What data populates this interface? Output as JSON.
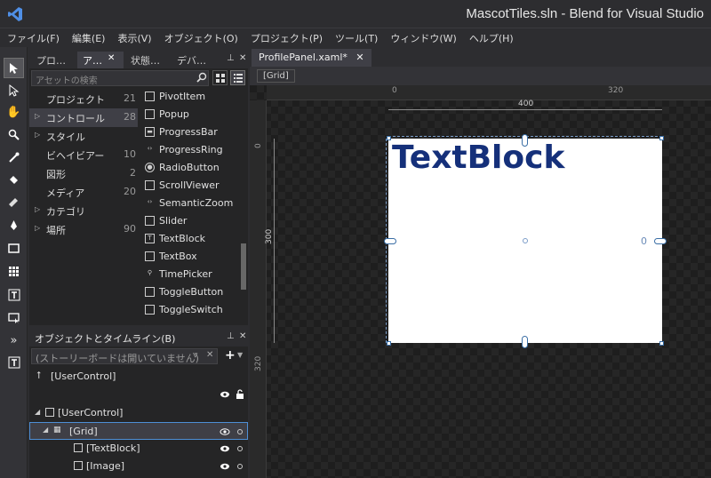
{
  "window": {
    "title": "MascotTiles.sln - Blend for Visual Studio"
  },
  "menu": [
    "ファイル(F)",
    "編集(E)",
    "表示(V)",
    "オブジェクト(O)",
    "プロジェクト(P)",
    "ツール(T)",
    "ウィンドウ(W)",
    "ヘルプ(H)"
  ],
  "panel_tabs": [
    "プロ…",
    "ア…",
    "状態…",
    "デバ…"
  ],
  "assets": {
    "search_placeholder": "アセットの検索",
    "categories": [
      {
        "label": "プロジェクト",
        "count": "21",
        "expandable": false
      },
      {
        "label": "コントロール",
        "count": "28",
        "expandable": true
      },
      {
        "label": "スタイル",
        "count": "",
        "expandable": true
      },
      {
        "label": "ビヘイビアー",
        "count": "10",
        "expandable": false
      },
      {
        "label": "図形",
        "count": "2",
        "expandable": false
      },
      {
        "label": "メディア",
        "count": "20",
        "expandable": false
      },
      {
        "label": "カテゴリ",
        "count": "",
        "expandable": true
      },
      {
        "label": "場所",
        "count": "90",
        "expandable": true
      }
    ],
    "items": [
      "PivotItem",
      "Popup",
      "ProgressBar",
      "ProgressRing",
      "RadioButton",
      "ScrollViewer",
      "SemanticZoom",
      "Slider",
      "TextBlock",
      "TextBox",
      "TimePicker",
      "ToggleButton",
      "ToggleSwitch"
    ]
  },
  "objects": {
    "title": "オブジェクトとタイムライン(B)",
    "storyboard_placeholder": "(ストーリーボードは開いていません)",
    "tree": [
      "[UserControl]",
      "[UserControl]",
      "[Grid]",
      "[TextBlock]",
      "[Image]"
    ]
  },
  "document": {
    "tab": "ProfilePanel.xaml*",
    "breadcrumb": "[Grid]",
    "ruler_top": [
      "0",
      "320"
    ],
    "ruler_left": [
      "0",
      "320"
    ],
    "width_label": "400",
    "height_label": "300",
    "textblock_text": "TextBlock",
    "margin_label": "0"
  }
}
